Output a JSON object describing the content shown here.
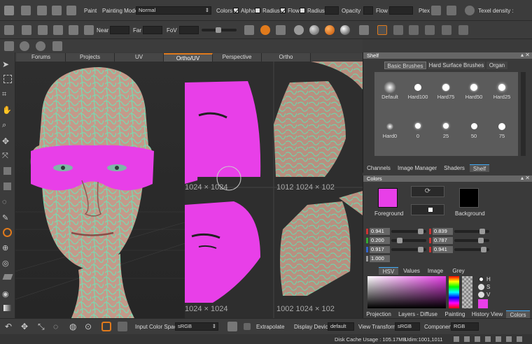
{
  "toolbar1": {
    "paint_label": "Paint",
    "painting_mode_label": "Painting Mode",
    "painting_mode_value": "Normal",
    "colors_label": "Colors",
    "alpha_label": "Alpha",
    "radius_label": "Radius",
    "flow_label": "Flow",
    "radius2_label": "Radius",
    "opacity_label": "Opacity",
    "flow2_label": "Flow",
    "ptex_label": "Ptex",
    "texel_label": "Texel density :"
  },
  "toolbar2": {
    "near_label": "Near",
    "far_label": "Far",
    "fov_label": "FoV"
  },
  "viewport_tabs": [
    "Forums",
    "Projects",
    "UV",
    "Ortho/UV",
    "Perspective",
    "Ortho"
  ],
  "uv_overlay": {
    "tl": "1024 × 1024",
    "tr": "1012 1024 × 102",
    "bl": "1024 × 1024",
    "br": "1002 1024 × 102"
  },
  "shelf": {
    "title": "Shelf",
    "tabs": [
      "Basic Brushes",
      "Hard Surface Brushes",
      "Organ"
    ],
    "brushes_row1": [
      "Default",
      "Hard100",
      "Hard75",
      "Hard50",
      "Hard25"
    ],
    "brushes_row2": [
      "Hard0",
      "0",
      "25",
      "50",
      "75"
    ],
    "bottom_tabs": [
      "Channels",
      "Image Manager",
      "Shaders",
      "Shelf"
    ]
  },
  "colors": {
    "title": "Colors",
    "foreground_label": "Foreground",
    "background_label": "Background",
    "foreground_color": "#e83fe8",
    "background_color": "#000000",
    "values_left": [
      "0.941",
      "0.200",
      "0.917",
      "1.000"
    ],
    "values_right": [
      "0.839",
      "0.787",
      "0.941"
    ],
    "tabs": [
      "HSV",
      "Values",
      "Image",
      "Grey"
    ],
    "radio": [
      "H",
      "S",
      "V"
    ]
  },
  "bottom_panel_tabs": [
    "Projection",
    "Layers - Diffuse",
    "Painting",
    "History View",
    "Colors"
  ],
  "bottom_toolbar": {
    "input_color_space_label": "Input Color Space",
    "input_color_space_value": "sRGB",
    "extrapolate_label": "Extrapolate",
    "display_device_label": "Display Device",
    "display_device_value": "default",
    "view_transform_label": "View Transform",
    "view_transform_value": "sRGB",
    "component_label": "Component",
    "component_value": "RGB"
  },
  "status": {
    "disk_cache": "Disk Cache Usage : 105.17MB",
    "udim": "Udim:1001,1011"
  }
}
